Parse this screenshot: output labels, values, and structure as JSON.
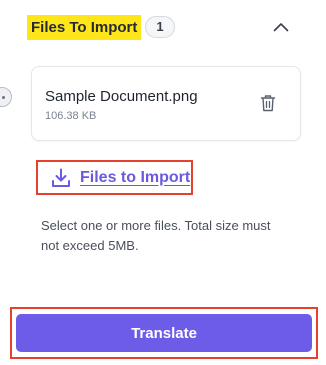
{
  "section": {
    "title": "Files To Import",
    "count": "1",
    "title_highlight_color": "#ffe61a",
    "toggle_icon": "chevron-up-icon"
  },
  "files": [
    {
      "name": "Sample Document.png",
      "size": "106.38 KB",
      "delete_icon": "trash-icon"
    }
  ],
  "import_link": {
    "label": "Files to Import",
    "icon": "download-icon",
    "color": "#6a5ae0"
  },
  "help_text": "Select one or more files. Total size must not exceed 5MB.",
  "translate_button": {
    "label": "Translate",
    "color": "#6c5ce7"
  },
  "annotation_color": "#e8402e"
}
